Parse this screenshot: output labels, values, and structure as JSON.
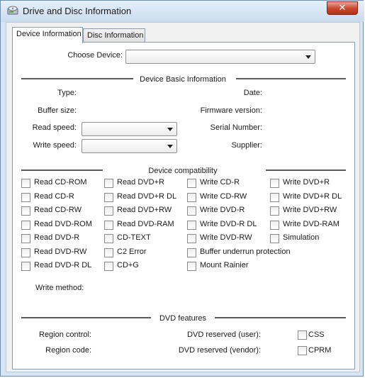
{
  "window": {
    "title": "Drive and Disc Information",
    "close_glyph": "✕",
    "icon": "disc-drive-icon"
  },
  "tabs": [
    {
      "label": "Device Information",
      "active": true
    },
    {
      "label": "Disc Information",
      "active": false
    }
  ],
  "choose_device": {
    "label": "Choose Device:",
    "value": ""
  },
  "basic": {
    "heading": "Device Basic Information",
    "type_label": "Type:",
    "date_label": "Date:",
    "buffer_label": "Buffer size:",
    "firmware_label": "Firmware version:",
    "read_speed_label": "Read speed:",
    "serial_label": "Serial Number:",
    "write_speed_label": "Write speed:",
    "supplier_label": "Supplier:",
    "read_speed_value": "",
    "write_speed_value": ""
  },
  "compat": {
    "heading": "Device compatibility",
    "col1": [
      "Read CD-ROM",
      "Read CD-R",
      "Read CD-RW",
      "Read DVD-ROM",
      "Read DVD-R",
      "Read DVD-RW",
      "Read DVD-R DL"
    ],
    "col2": [
      "Read DVD+R",
      "Read DVD+R DL",
      "Read DVD+RW",
      "Read DVD-RAM",
      "CD-TEXT",
      "C2 Error",
      "CD+G"
    ],
    "col3": [
      "Write CD-R",
      "Write CD-RW",
      "Write DVD-R",
      "Write DVD-R DL",
      "Write DVD-RW",
      "Buffer underrun protection",
      "Mount Rainier"
    ],
    "col4": [
      "Write DVD+R",
      "Write DVD+R DL",
      "Write DVD+RW",
      "Write DVD-RAM",
      "Simulation"
    ],
    "write_method_label": "Write method:"
  },
  "dvd": {
    "heading": "DVD features",
    "region_control_label": "Region control:",
    "region_code_label": "Region code:",
    "reserved_user_label": "DVD reserved (user):",
    "reserved_vendor_label": "DVD reserved (vendor):",
    "css_label": "CSS",
    "cprm_label": "CPRM"
  }
}
